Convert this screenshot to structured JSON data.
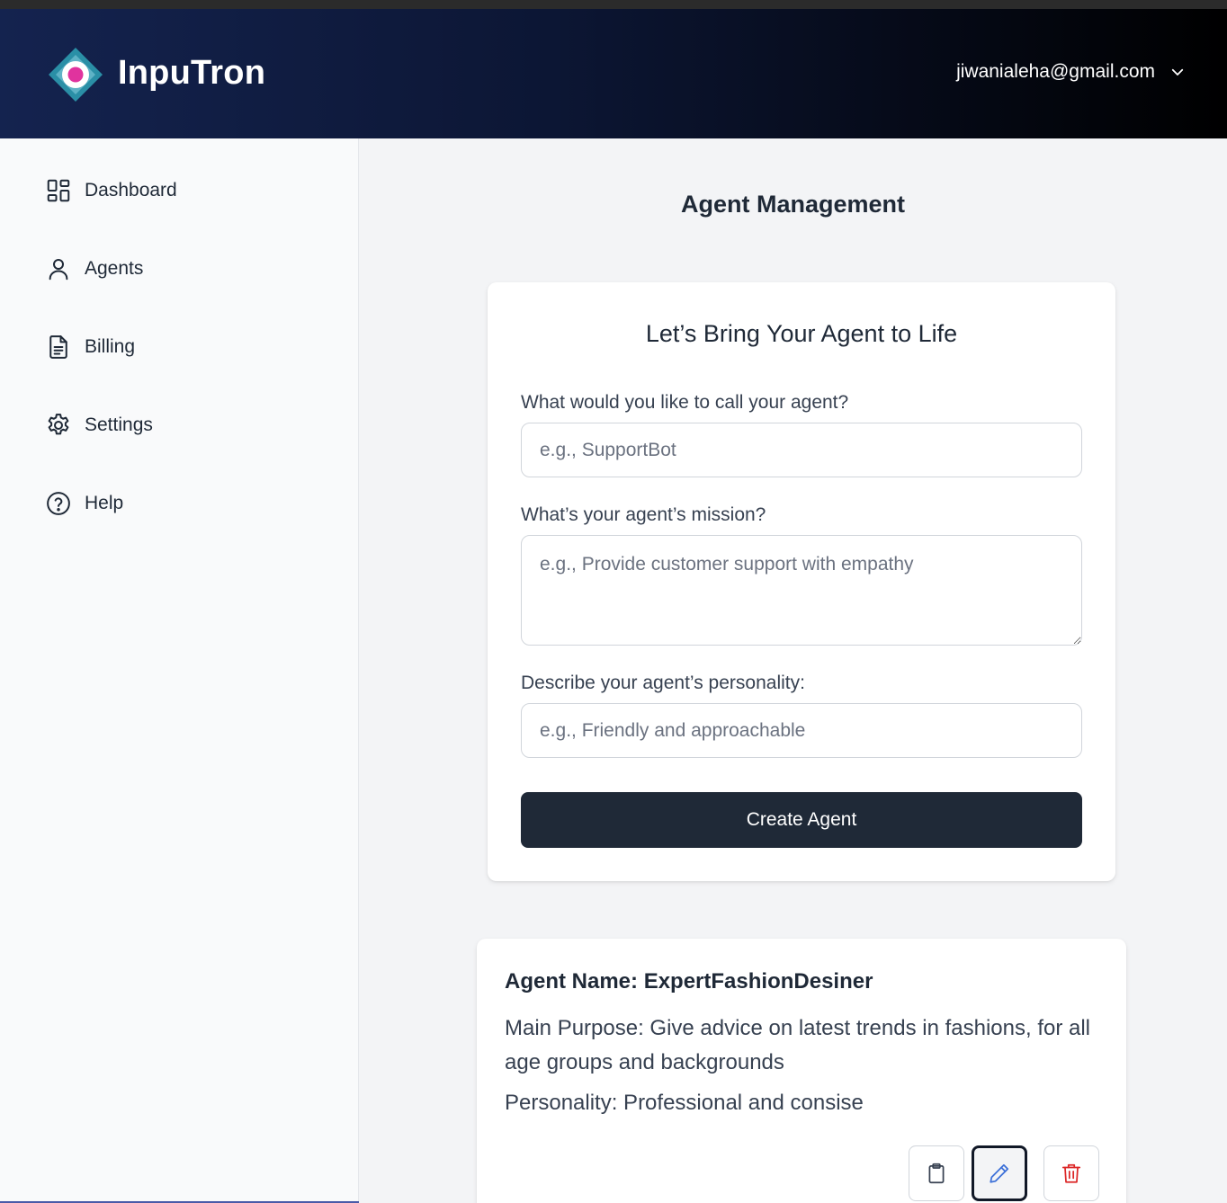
{
  "app": {
    "brand": "InpuTron",
    "user_email": "jiwanialeha@gmail.com"
  },
  "sidebar": {
    "items": [
      {
        "label": "Dashboard",
        "icon": "dashboard-grid-icon"
      },
      {
        "label": "Agents",
        "icon": "user-icon"
      },
      {
        "label": "Billing",
        "icon": "document-icon"
      },
      {
        "label": "Settings",
        "icon": "gear-icon"
      },
      {
        "label": "Help",
        "icon": "help-circle-icon"
      }
    ]
  },
  "main": {
    "title": "Agent Management"
  },
  "form": {
    "heading": "Let’s Bring Your Agent to Life",
    "name_label": "What would you like to call your agent?",
    "name_placeholder": "e.g., SupportBot",
    "mission_label": "What’s your agent’s mission?",
    "mission_placeholder": "e.g., Provide customer support with empathy",
    "personality_label": "Describe your agent’s personality:",
    "personality_placeholder": "e.g., Friendly and approachable",
    "submit_label": "Create Agent"
  },
  "agent_card": {
    "name_line": "Agent Name: ExpertFashionDesiner",
    "purpose_line": "Main Purpose: Give advice on latest trends in fashions, for all age groups and backgrounds",
    "personality_line": "Personality: Professional and consise"
  },
  "colors": {
    "header_start": "#14234f",
    "header_end": "#000000",
    "logo_teal": "#2a8fa6",
    "logo_pink": "#e0339e",
    "button_dark": "#1f2937",
    "edit_blue": "#3b6fd8",
    "delete_red": "#dc2626"
  }
}
